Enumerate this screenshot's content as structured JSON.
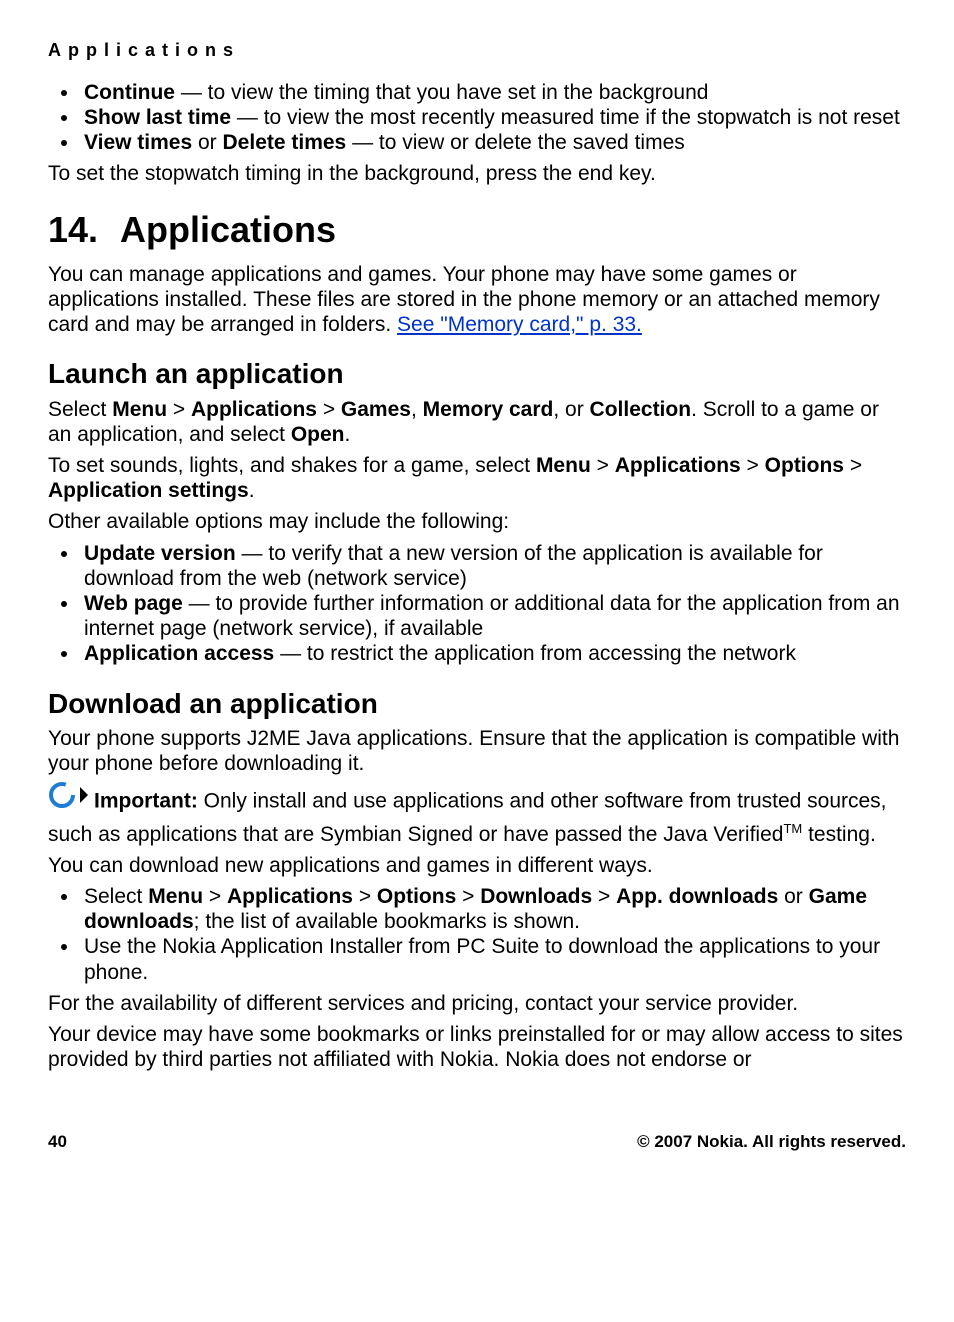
{
  "header": "Applications",
  "top_list": [
    {
      "b": "Continue",
      "rest": "  — to view the timing that you have set in the background"
    },
    {
      "b": "Show last time",
      "rest": "  — to view the most recently measured time if the stopwatch is not reset"
    },
    {
      "b1": "View times",
      "mid": " or ",
      "b2": "Delete times",
      "rest": " — to view or delete the saved times"
    }
  ],
  "p_after_top": "To set the stopwatch timing in the background, press the end key.",
  "h1_num": "14.",
  "h1_text": "Applications",
  "p_apps_intro_1": "You can manage applications and games. Your phone may have some games or applications installed. These files are stored in the phone memory or an attached memory card and may be arranged in folders. ",
  "link_memcard": "See \"Memory card,\" p. 33.",
  "h2_launch": "Launch an application",
  "launch_p1_pre": "Select ",
  "launch_p1_b1": "Menu",
  "gt": " > ",
  "launch_p1_b2": "Applications",
  "launch_p1_b3": "Games",
  "comma": ", ",
  "launch_p1_b4": "Memory card",
  "or": ", or ",
  "launch_p1_b5": "Collection",
  "launch_p1_mid": ". Scroll to a game or an application, and select ",
  "launch_p1_b6": "Open",
  "period": ".",
  "launch_p2_pre": "To set sounds, lights, and shakes for a game, select ",
  "launch_p2_b1": "Menu",
  "launch_p2_b2": "Applications",
  "launch_p2_b3": "Options",
  "launch_p2_b4": "Application settings",
  "launch_p3": "Other available options may include the following:",
  "launch_list": [
    {
      "b": "Update version",
      "rest": "  — to verify that a new version of the application is available for download from the web (network service)"
    },
    {
      "b": "Web page",
      "rest": " —  to provide further information or additional data for the application from an internet page (network service), if available"
    },
    {
      "b": "Application access",
      "rest": " —  to restrict the application from accessing the network"
    }
  ],
  "h2_download": "Download an application",
  "dl_p1": "Your phone supports J2ME Java applications. Ensure that the application is compatible with your phone before downloading it.",
  "important_label": "Important:",
  "important_text": "  Only install and use applications and other software from trusted sources, such as applications that are Symbian Signed or have passed the Java Verified",
  "tm": "TM",
  "important_tail": " testing.",
  "dl_p2": "You can download new applications and games in different ways.",
  "dl_li1_pre": "Select ",
  "dl_li1_b1": "Menu",
  "dl_li1_b2": "Applications",
  "dl_li1_b3": "Options",
  "dl_li1_b4": "Downloads",
  "dl_li1_b5": "App. downloads",
  "dl_li1_or": " or ",
  "dl_li1_b6": "Game downloads",
  "dl_li1_tail": "; the list of available bookmarks is shown.",
  "dl_li2": "Use the Nokia Application Installer from PC Suite to download the applications to your phone.",
  "dl_p3": "For the availability of different services and pricing, contact your service provider.",
  "dl_p4": "Your device may have some bookmarks or links preinstalled for or may allow access to sites provided by third parties not affiliated with Nokia. Nokia does not endorse or",
  "footer_page": "40",
  "footer_copy": "© 2007 Nokia. All rights reserved."
}
